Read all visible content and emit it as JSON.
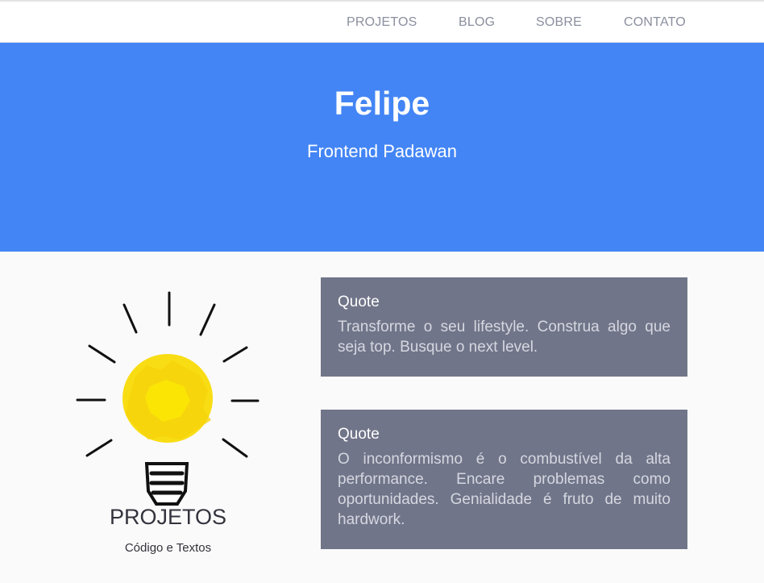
{
  "nav": {
    "items": [
      {
        "label": "PROJETOS"
      },
      {
        "label": "BLOG"
      },
      {
        "label": "SOBRE"
      },
      {
        "label": "CONTATO"
      }
    ]
  },
  "hero": {
    "title": "Felipe",
    "subtitle": "Frontend Padawan"
  },
  "projects": {
    "icon": "lightbulb-icon",
    "title": "PROJETOS",
    "subtitle": "Código e Textos"
  },
  "quotes": [
    {
      "title": "Quote",
      "text": "Transforme o seu lifestyle. Construa algo que seja top. Busque o next level."
    },
    {
      "title": "Quote",
      "text": "O inconformismo é o combustível da alta performance. Encare problemas como oportunidades. Genialidade é fruto de muito hardwork."
    }
  ],
  "colors": {
    "hero_bg": "#4385f5",
    "quote_bg": "#717589",
    "bulb_yellow": "#f9dd14",
    "nav_text": "#8a8f9e"
  }
}
